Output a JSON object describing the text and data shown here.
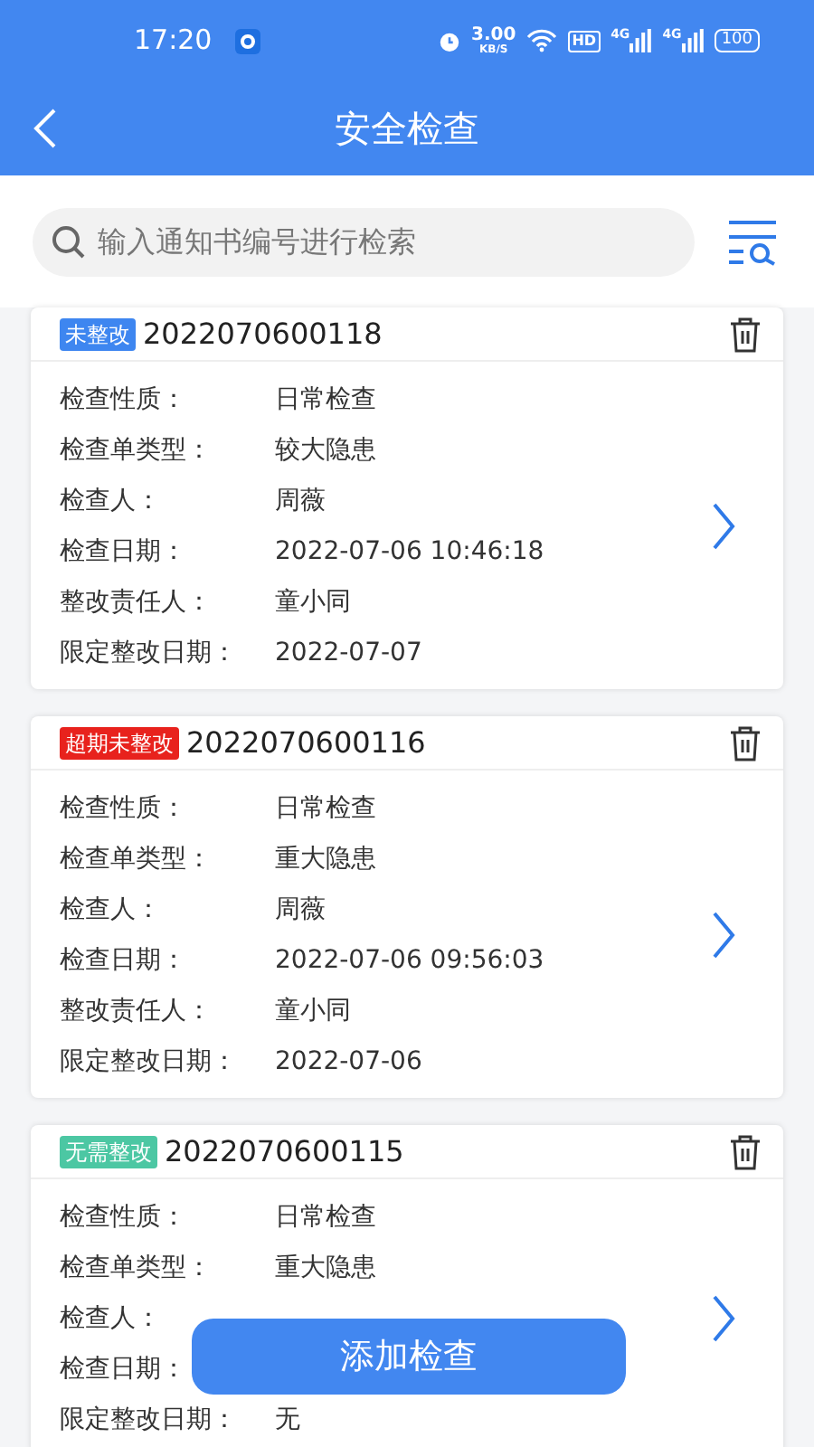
{
  "status_bar": {
    "time": "17:20",
    "net_speed": "3.00",
    "net_unit": "KB/S",
    "hd": "HD",
    "signals": [
      "4G",
      "4G"
    ],
    "battery": "100"
  },
  "header": {
    "title": "安全检查"
  },
  "search": {
    "placeholder": "输入通知书编号进行检索"
  },
  "records": [
    {
      "status": "未整改",
      "color": "#3e86f0",
      "number": "2022070600118",
      "fields": [
        {
          "label": "检查性质：",
          "value": "日常检查"
        },
        {
          "label": "检查单类型：",
          "value": "较大隐患"
        },
        {
          "label": "检查人：",
          "value": "周薇"
        },
        {
          "label": "检查日期：",
          "value": "2022-07-06 10:46:18"
        },
        {
          "label": "整改责任人：",
          "value": "童小同"
        },
        {
          "label": "限定整改日期：",
          "value": "2022-07-07"
        }
      ]
    },
    {
      "status": "超期未整改",
      "color": "#e8221d",
      "number": "2022070600116",
      "fields": [
        {
          "label": "检查性质：",
          "value": "日常检查"
        },
        {
          "label": "检查单类型：",
          "value": "重大隐患"
        },
        {
          "label": "检查人：",
          "value": "周薇"
        },
        {
          "label": "检查日期：",
          "value": "2022-07-06 09:56:03"
        },
        {
          "label": "整改责任人：",
          "value": "童小同"
        },
        {
          "label": "限定整改日期：",
          "value": "2022-07-06"
        }
      ]
    },
    {
      "status": "无需整改",
      "color": "#4cc7a3",
      "number": "2022070600115",
      "fields": [
        {
          "label": "检查性质：",
          "value": "日常检查"
        },
        {
          "label": "检查单类型：",
          "value": "重大隐患"
        },
        {
          "label": "检查人："
        },
        {
          "label": "检查日期："
        },
        {
          "label": "限定整改日期：",
          "value": "无"
        }
      ]
    }
  ],
  "add_button": {
    "label": "添加检查"
  }
}
